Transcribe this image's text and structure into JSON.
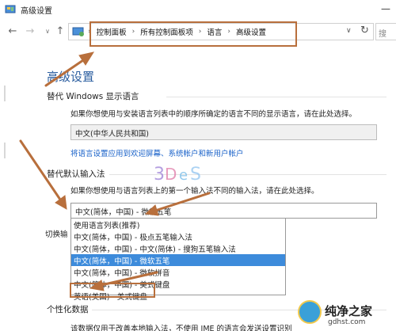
{
  "window": {
    "title": "高级设置"
  },
  "nav": {
    "breadcrumbs": [
      "控制面板",
      "所有控制面板项",
      "语言",
      "高级设置"
    ]
  },
  "main": {
    "title": "高级设置",
    "display_language": {
      "heading": "替代 Windows 显示语言",
      "desc": "如果你想使用与安装语言列表中的顺序所确定的语言不同的显示语言，请在此处选择。",
      "selected": "中文(中华人民共和国)",
      "link": "将语言设置应用到欢迎屏幕、系统帐户和新用户帐户"
    },
    "input_method": {
      "heading": "替代默认输入法",
      "desc": "如果你想使用与语言列表上的第一个输入法不同的输入法，请在此处选择。",
      "selected": "中文(简体，中国) - 微软五笔",
      "options": [
        "使用语言列表(推荐)",
        "中文(简体，中国) - 极点五笔输入法",
        "中文(简体，中国) - 中文(简体) - 搜狗五笔输入法",
        "中文(简体，中国) - 微软五笔",
        "中文(简体，中国) - 微软拼音",
        "中文(简体，中国) - 美式键盘",
        "英语(美国) - 美式键盘"
      ],
      "selected_option_index": 3
    },
    "switch_partial": "切换输",
    "personalization": {
      "heading": "个性化数据",
      "desc_partial": "该数据仅用于改善本地输入法，不使用 IME 的语言会发送设置识别"
    }
  },
  "watermark": {
    "brand": "纯净之家",
    "url": "gdhst.com"
  },
  "colors": {
    "accent_title": "#2a5d9f",
    "link": "#1a62c9",
    "selection": "#3d8bdb",
    "annotation": "#b86f3c"
  }
}
